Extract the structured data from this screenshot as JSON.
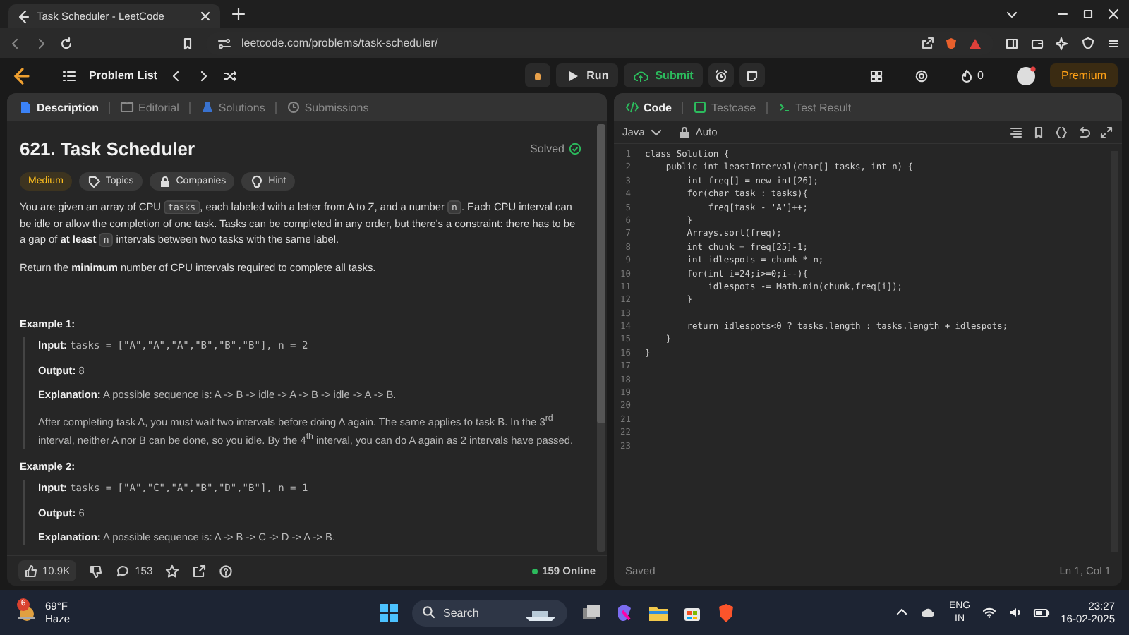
{
  "browser": {
    "tab_title": "Task Scheduler - LeetCode",
    "url": "leetcode.com/problems/task-scheduler/"
  },
  "topbar": {
    "problem_list": "Problem List",
    "run": "Run",
    "submit": "Submit",
    "streak": "0",
    "premium": "Premium"
  },
  "description": {
    "tabs": [
      {
        "label": "Description",
        "selected": true
      },
      {
        "label": "Editorial",
        "selected": false
      },
      {
        "label": "Solutions",
        "selected": false
      },
      {
        "label": "Submissions",
        "selected": false
      }
    ],
    "title": "621. Task Scheduler",
    "status": "Solved",
    "tags": [
      {
        "label": "Medium",
        "kind": "difficulty"
      },
      {
        "label": "Topics",
        "kind": "topics"
      },
      {
        "label": "Companies",
        "kind": "companies"
      },
      {
        "label": "Hint",
        "kind": "hint"
      }
    ],
    "paragraphs": [
      [
        {
          "kind": "text",
          "text": "You are given an array of CPU "
        },
        {
          "kind": "code",
          "text": "tasks"
        },
        {
          "kind": "text",
          "text": ", each labeled with a letter from A to Z, and a number "
        },
        {
          "kind": "code",
          "text": "n"
        },
        {
          "kind": "text",
          "text": ". Each CPU interval can be idle or allow the completion of one task. Tasks can be completed in any order, but there's a constraint: there has to be a gap of **at least** "
        },
        {
          "kind": "code",
          "text": "n"
        },
        {
          "kind": "text",
          "text": " intervals between two tasks with the same label."
        }
      ],
      [
        {
          "kind": "text",
          "text": "Return the **minimum** number of CPU intervals required to complete all tasks."
        }
      ]
    ],
    "examples": [
      {
        "heading": "Example 1:",
        "items": [
          {
            "kind": "code",
            "label": "Input:",
            "text": "tasks = [\"A\",\"A\",\"A\",\"B\",\"B\",\"B\"], n = 2"
          },
          {
            "kind": "text",
            "label": "Output:",
            "text": "8"
          },
          {
            "kind": "text",
            "label": "Explanation:",
            "text": "A possible sequence is: A -> B -> idle -> A -> B -> idle -> A -> B."
          },
          {
            "kind": "text",
            "text": "After completing task A, you must wait two intervals before doing A again. The same applies to task B. In the 3$^{rd}$ interval, neither A nor B can be done, so you idle. By the 4$^{th}$ interval, you can do A again as 2 intervals have passed."
          }
        ]
      },
      {
        "heading": "Example 2:",
        "items": [
          {
            "kind": "code",
            "label": "Input:",
            "text": "tasks = [\"A\",\"C\",\"A\",\"B\",\"D\",\"B\"], n = 1"
          },
          {
            "kind": "text",
            "label": "Output:",
            "text": "6"
          },
          {
            "kind": "text",
            "label": "Explanation:",
            "text": "A possible sequence is: A -> B -> C -> D -> A -> B."
          }
        ]
      }
    ],
    "likes": "10.9K",
    "comments": "153",
    "online": "159 Online"
  },
  "editor": {
    "tabs": [
      {
        "label": "Code",
        "selected": true
      },
      {
        "label": "Testcase",
        "selected": false
      },
      {
        "label": "Test Result",
        "selected": false
      }
    ],
    "language": "Java",
    "mode": "Auto",
    "lines": [
      {
        "number": "1",
        "code": "class Solution {"
      },
      {
        "number": "2",
        "code": "    public int leastInterval(char[] tasks, int n) {"
      },
      {
        "number": "3",
        "code": "        int freq[] = new int[26];"
      },
      {
        "number": "4",
        "code": "        for(char task : tasks){"
      },
      {
        "number": "5",
        "code": "            freq[task - 'A']++;"
      },
      {
        "number": "6",
        "code": "        }"
      },
      {
        "number": "7",
        "code": "        Arrays.sort(freq);"
      },
      {
        "number": "8",
        "code": "        int chunk = freq[25]-1;"
      },
      {
        "number": "9",
        "code": "        int idlespots = chunk * n;"
      },
      {
        "number": "10",
        "code": "        for(int i=24;i>=0;i--){"
      },
      {
        "number": "11",
        "code": "            idlespots -= Math.min(chunk,freq[i]);"
      },
      {
        "number": "12",
        "code": "        }"
      },
      {
        "number": "13"
      },
      {
        "number": "14",
        "code": "        return idlespots<0 ? tasks.length : tasks.length + idlespots;"
      },
      {
        "number": "15",
        "code": "    }"
      },
      {
        "number": "16",
        "code": "}"
      },
      {
        "number": "17"
      },
      {
        "number": "18"
      },
      {
        "number": "19"
      },
      {
        "number": "20"
      },
      {
        "number": "21"
      },
      {
        "number": "22"
      },
      {
        "number": "23"
      }
    ],
    "status": "Saved",
    "position": "Ln 1, Col 1"
  },
  "taskbar": {
    "weather_badge": "6",
    "temperature": "69°F",
    "condition": "Haze",
    "search_placeholder": "Search",
    "language": "ENG",
    "region": "IN",
    "time": "23:27",
    "date": "16-02-2025"
  }
}
